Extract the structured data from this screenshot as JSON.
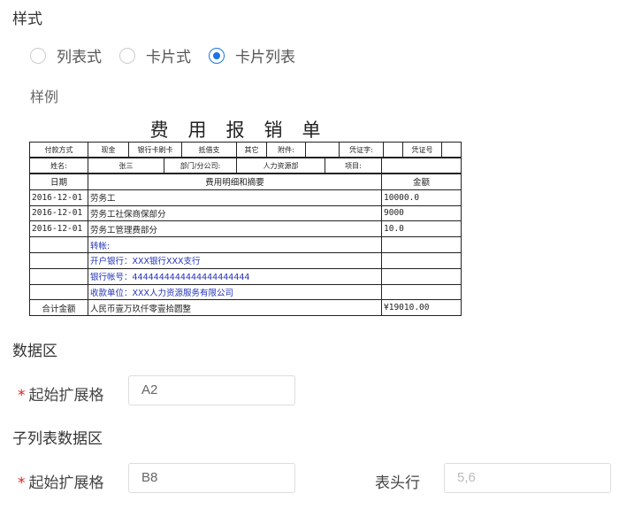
{
  "style_section": {
    "title": "样式",
    "options": [
      "列表式",
      "卡片式",
      "卡片列表"
    ],
    "selected_index": 2,
    "sample_label": "样例"
  },
  "sample_document": {
    "title": "费用报销单",
    "header_row1": [
      "付款方式",
      "现金",
      "银行卡刷卡",
      "抵借支",
      "其它",
      "附件:",
      "",
      "凭证字:",
      "",
      "凭证号",
      ""
    ],
    "header_row2": [
      "姓名:",
      "张三",
      "部门/分公司:",
      "人力资源部",
      "项目:",
      ""
    ],
    "columns": [
      "日期",
      "费用明细和摘要",
      "金额"
    ],
    "rows": [
      {
        "date": "2016-12-01",
        "desc": "劳务工",
        "amount": "10000.0"
      },
      {
        "date": "2016-12-01",
        "desc": "劳务工社保商保部分",
        "amount": "9000"
      },
      {
        "date": "2016-12-01",
        "desc": "劳务工管理费部分",
        "amount": "10.0"
      },
      {
        "date": "",
        "desc": "转帐:",
        "amount": ""
      },
      {
        "date": "",
        "desc": "开户银行：XXX银行XXX支行",
        "amount": ""
      },
      {
        "date": "",
        "desc": "银行帐号：4444444444444444444444",
        "amount": ""
      },
      {
        "date": "",
        "desc": "收款单位：XXX人力资源服务有限公司",
        "amount": ""
      }
    ],
    "total": {
      "label": "合计金额",
      "text": "人民币壹万玖仟零壹拾圆整",
      "amount": "¥19010.00"
    }
  },
  "data_section": {
    "title": "数据区",
    "start_cell_label": "起始扩展格",
    "start_cell_value": "A2"
  },
  "sublist_section": {
    "title": "子列表数据区",
    "start_cell_label": "起始扩展格",
    "start_cell_value": "B8",
    "header_row_label": "表头行",
    "header_row_placeholder": "5,6"
  },
  "colors": {
    "accent": "#1a73e8",
    "required": "#e02020",
    "link_text": "#2233bb"
  }
}
